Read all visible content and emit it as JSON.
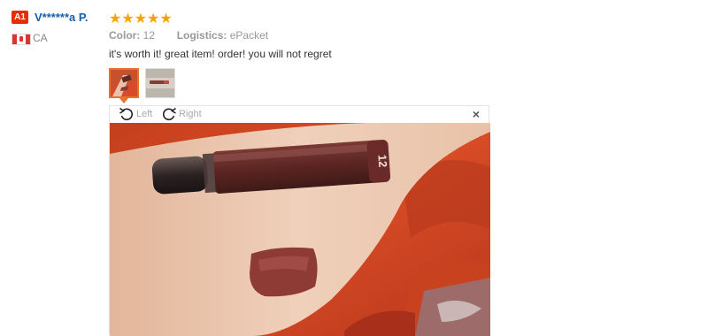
{
  "reviewer": {
    "badge": "A1",
    "name": "V******a P.",
    "country": "CA"
  },
  "review": {
    "rating": 5,
    "stars": "★★★★★",
    "color_label": "Color:",
    "color_value": "12",
    "logistics_label": "Logistics:",
    "logistics_value": "ePacket",
    "text": "it's worth it! great item! order! you will not regret"
  },
  "viewer": {
    "rotate_left_label": "Left",
    "rotate_right_label": "Right",
    "close_label": "×",
    "tube_label": "12"
  },
  "colors": {
    "badge_red": "#e62e04",
    "name_blue": "#1a5ea8",
    "star_gold": "#f2a500",
    "thumb_border": "#e8712e"
  }
}
